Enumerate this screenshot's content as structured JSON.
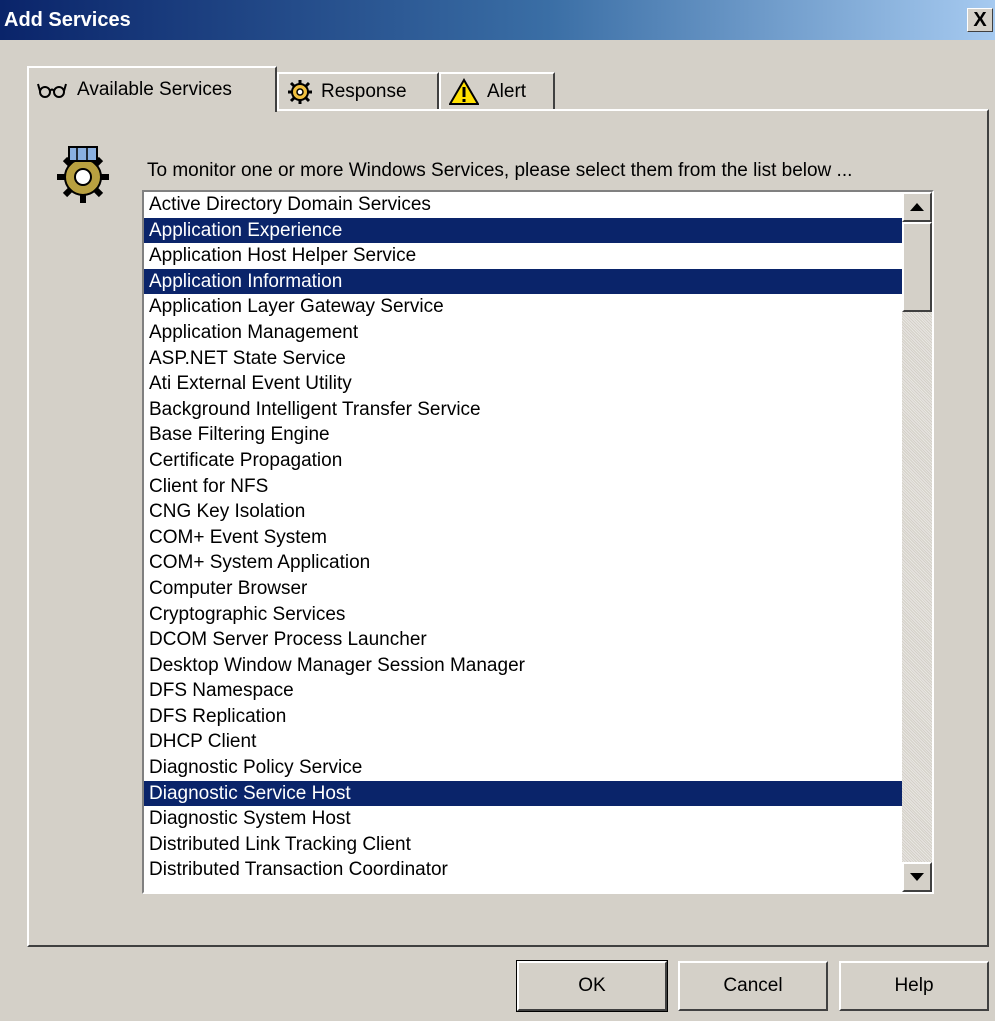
{
  "window": {
    "title": "Add Services",
    "close_label": "X"
  },
  "tabs": [
    {
      "label": "Available Services",
      "icon": "glasses-icon",
      "active": true
    },
    {
      "label": "Response",
      "icon": "gear-icon",
      "active": false
    },
    {
      "label": "Alert",
      "icon": "warning-icon",
      "active": false
    }
  ],
  "panel": {
    "instruction": "To monitor one or more Windows Services, please select them from the list below ...",
    "icon": "services-gear-icon"
  },
  "services": [
    {
      "name": "Active Directory Domain Services",
      "selected": false
    },
    {
      "name": "Application Experience",
      "selected": true
    },
    {
      "name": "Application Host Helper Service",
      "selected": false
    },
    {
      "name": "Application Information",
      "selected": true
    },
    {
      "name": "Application Layer Gateway Service",
      "selected": false
    },
    {
      "name": "Application Management",
      "selected": false
    },
    {
      "name": "ASP.NET State Service",
      "selected": false
    },
    {
      "name": "Ati External Event Utility",
      "selected": false
    },
    {
      "name": "Background Intelligent Transfer Service",
      "selected": false
    },
    {
      "name": "Base Filtering Engine",
      "selected": false
    },
    {
      "name": "Certificate Propagation",
      "selected": false
    },
    {
      "name": "Client for NFS",
      "selected": false
    },
    {
      "name": "CNG Key Isolation",
      "selected": false
    },
    {
      "name": "COM+ Event System",
      "selected": false
    },
    {
      "name": "COM+ System Application",
      "selected": false
    },
    {
      "name": "Computer Browser",
      "selected": false
    },
    {
      "name": "Cryptographic Services",
      "selected": false
    },
    {
      "name": "DCOM Server Process Launcher",
      "selected": false
    },
    {
      "name": "Desktop Window Manager Session Manager",
      "selected": false
    },
    {
      "name": "DFS Namespace",
      "selected": false
    },
    {
      "name": "DFS Replication",
      "selected": false
    },
    {
      "name": "DHCP Client",
      "selected": false
    },
    {
      "name": "Diagnostic Policy Service",
      "selected": false
    },
    {
      "name": "Diagnostic Service Host",
      "selected": true
    },
    {
      "name": "Diagnostic System Host",
      "selected": false
    },
    {
      "name": "Distributed Link Tracking Client",
      "selected": false
    },
    {
      "name": "Distributed Transaction Coordinator",
      "selected": false
    }
  ],
  "buttons": {
    "ok": "OK",
    "cancel": "Cancel",
    "help": "Help"
  },
  "colors": {
    "selection": "#0a246a",
    "face": "#d4d0c8"
  }
}
